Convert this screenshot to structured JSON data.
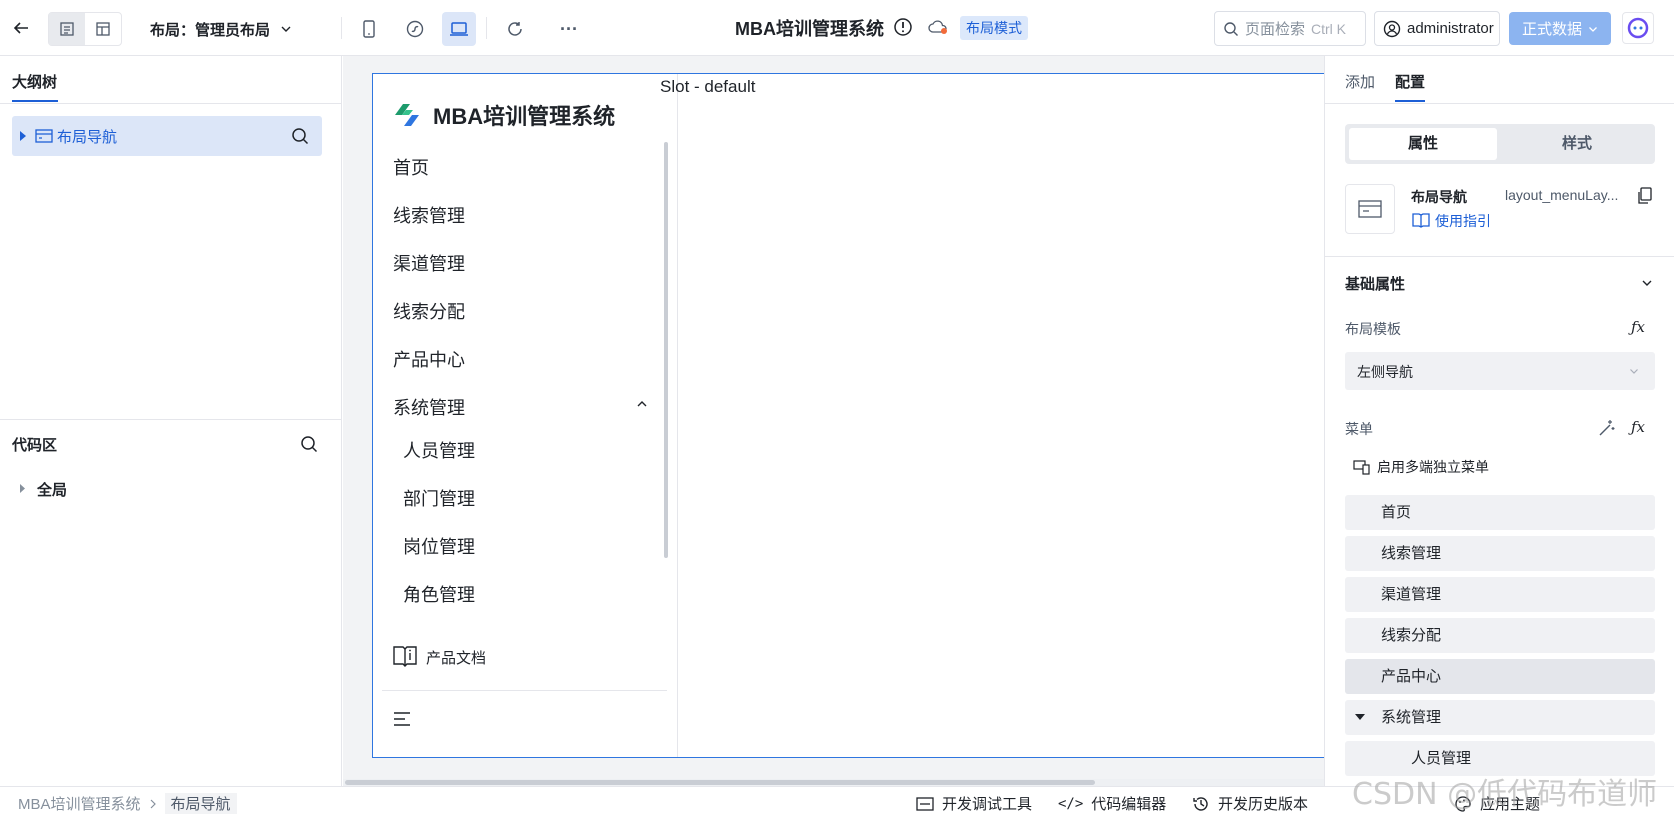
{
  "topbar": {
    "layout_label": "布局：管理员布局",
    "app_title": "MBA培训管理系统",
    "mode_badge": "布局模式",
    "search_placeholder": "页面检索",
    "search_shortcut": "Ctrl K",
    "user": "administrator",
    "data_button": "正式数据",
    "more": "···"
  },
  "left": {
    "outline_tab": "大纲树",
    "outline_item": "布局导航",
    "code_title": "代码区",
    "code_item": "全局"
  },
  "canvas": {
    "logo_text": "MBA培训管理系统",
    "slot_text": "Slot - default",
    "menu": [
      "首页",
      "线索管理",
      "渠道管理",
      "线索分配",
      "产品中心",
      "系统管理"
    ],
    "submenu": [
      "人员管理",
      "部门管理",
      "岗位管理",
      "角色管理"
    ],
    "doc_link": "产品文档"
  },
  "right": {
    "tabs": [
      "添加",
      "配置"
    ],
    "seg": [
      "属性",
      "样式"
    ],
    "component_name": "布局导航",
    "component_id": "layout_menuLay...",
    "guide_link": "使用指引",
    "section_title": "基础属性",
    "template_label": "布局模板",
    "template_value": "左侧导航",
    "menu_label": "菜单",
    "multi_menu": "启用多端独立菜单",
    "menu_items": [
      "首页",
      "线索管理",
      "渠道管理",
      "线索分配",
      "产品中心",
      "系统管理",
      "人员管理"
    ]
  },
  "bottom": {
    "breadcrumb": [
      "MBA培训管理系统",
      "布局导航"
    ],
    "dev_tools": "开发调试工具",
    "code_editor": "代码编辑器",
    "history": "开发历史版本",
    "theme": "应用主题"
  },
  "watermark": "CSDN @低代码布道师",
  "colors": {
    "accent": "#1d5fd6",
    "selected_bg": "#dce6f8",
    "data_button": "#8cb4f0"
  }
}
